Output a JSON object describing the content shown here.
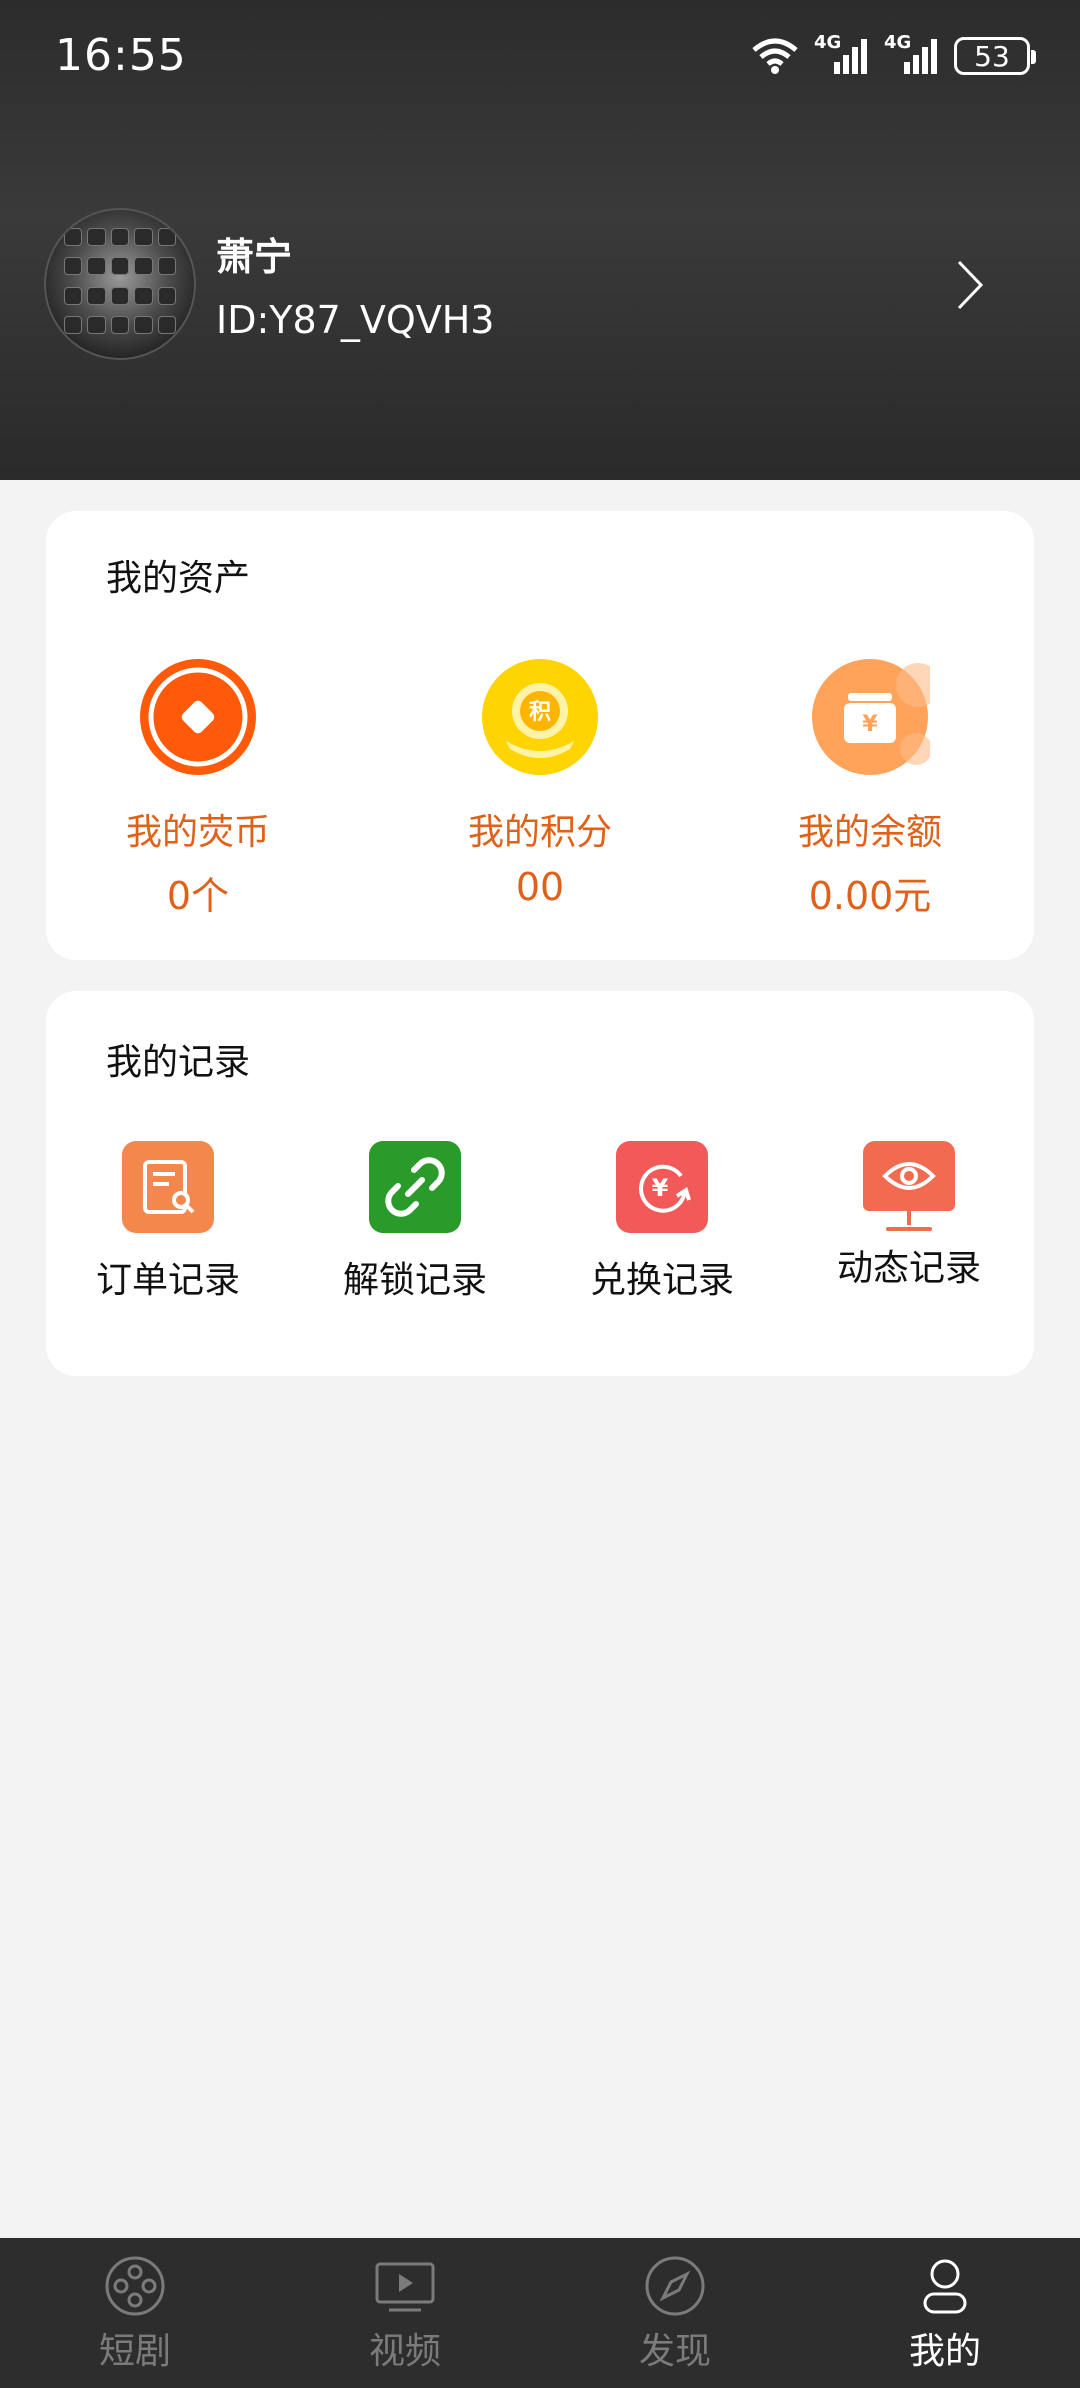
{
  "status_bar": {
    "time": "16:55",
    "signal1": "4G",
    "signal2": "4G",
    "battery": "53"
  },
  "profile": {
    "name": "萧宁",
    "id": "ID:Y87_VQVH3"
  },
  "assets": {
    "title": "我的资产",
    "items": [
      {
        "label": "我的荧币",
        "value": "0个",
        "icon": "coin-icon",
        "color": "#ff5a0a"
      },
      {
        "label": "我的积分",
        "value": "00",
        "icon": "points-icon",
        "color": "#ffd400",
        "badge": "积"
      },
      {
        "label": "我的余额",
        "value": "0.00元",
        "icon": "wallet-icon",
        "color": "#ffa25a",
        "badge": "¥"
      }
    ]
  },
  "records": {
    "title": "我的记录",
    "items": [
      {
        "label": "订单记录",
        "icon": "order-icon",
        "color": "#f4874b"
      },
      {
        "label": "解锁记录",
        "icon": "link-icon",
        "color": "#2a9b2a"
      },
      {
        "label": "兑换记录",
        "icon": "exchange-icon",
        "color": "#f25a5a",
        "badge": "¥"
      },
      {
        "label": "动态记录",
        "icon": "eye-icon",
        "color": "#f26a50"
      }
    ]
  },
  "nav": {
    "items": [
      {
        "label": "短剧",
        "icon": "film-reel-icon"
      },
      {
        "label": "视频",
        "icon": "video-icon"
      },
      {
        "label": "发现",
        "icon": "compass-icon"
      },
      {
        "label": "我的",
        "icon": "user-icon",
        "active": true
      }
    ]
  },
  "colors": {
    "accent": "#e0621a",
    "header_bg": "#2c2c2c",
    "nav_bg": "#2d2d2d"
  }
}
